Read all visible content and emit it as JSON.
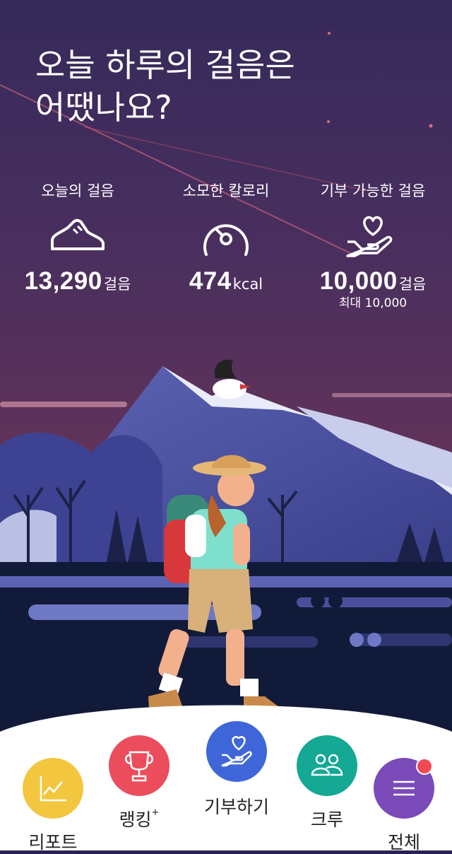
{
  "headline": {
    "line1": "오늘 하루의 걸음은",
    "line2": "어땠나요?"
  },
  "stats": [
    {
      "label": "오늘의 걸음",
      "icon": "sneaker-icon",
      "value": "13,290",
      "unit": "걸음"
    },
    {
      "label": "소모한 칼로리",
      "icon": "speedometer-icon",
      "value": "474",
      "unit": "kcal"
    },
    {
      "label": "기부 가능한 걸음",
      "icon": "heart-hand-icon",
      "value": "10,000",
      "unit": "걸음",
      "sub": "최대 10,000"
    }
  ],
  "nav": [
    {
      "label": "리포트",
      "icon": "chart-icon",
      "color": "#f3c63f"
    },
    {
      "label": "랭킹",
      "suffix": "+",
      "icon": "trophy-icon",
      "color": "#ec4d5c"
    },
    {
      "label": "기부하기",
      "icon": "heart-hand-icon",
      "color": "#3f66d8"
    },
    {
      "label": "크루",
      "icon": "people-icon",
      "color": "#15a894"
    },
    {
      "label": "전체",
      "icon": "menu-icon",
      "color": "#7a4bb8",
      "has_badge": true
    }
  ],
  "colors": {
    "sky_top": "#3a2c5c",
    "sky_bottom": "#6a3558",
    "mountain": "#4a4f9c",
    "ground": "#111a38",
    "panel": "#ffffff"
  }
}
